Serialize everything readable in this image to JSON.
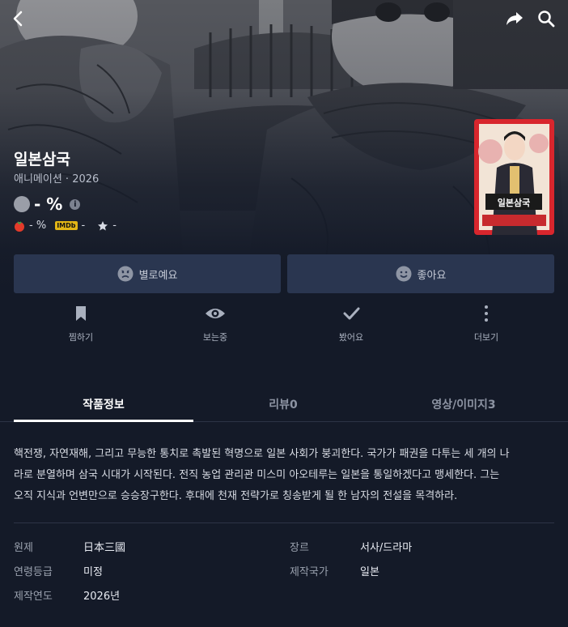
{
  "header": {
    "icons": [
      "back-icon",
      "share-icon",
      "search-icon"
    ]
  },
  "movie": {
    "title": "일본삼국",
    "meta": "애니메이션 · 2026",
    "score": "- %",
    "tomato_score": "- %",
    "imdb_badge": "IMDb",
    "imdb_score": "-",
    "star_score": "-",
    "poster_text": "일본삼국"
  },
  "buttons": {
    "dislike": "별로예요",
    "like": "좋아요"
  },
  "actions": [
    {
      "label": "찜하기",
      "icon": "bookmark-icon"
    },
    {
      "label": "보는중",
      "icon": "eye-icon"
    },
    {
      "label": "봤어요",
      "icon": "check-icon"
    },
    {
      "label": "더보기",
      "icon": "more-vertical-icon"
    }
  ],
  "tabs": [
    {
      "label": "작품정보",
      "active": true
    },
    {
      "label": "리뷰0",
      "active": false
    },
    {
      "label": "영상/이미지3",
      "active": false
    }
  ],
  "synopsis": {
    "line1": "핵전쟁, 자연재해, 그리고 무능한 통치로 촉발된 혁명으로 일본 사회가 붕괴한다. 국가가 패권을 다투는 세 개의 나",
    "line2": "라로 분열하며 삼국 시대가 시작된다. 전직 농업 관리관 미스미 아오테루는 일본을 통일하겠다고 맹세한다. 그는",
    "line3": "오직 지식과 언변만으로 승승장구한다. 후대에 천재 전략가로 칭송받게 될 한 남자의 전설을 목격하라."
  },
  "info": {
    "original_title_label": "원제",
    "original_title": "日本三國",
    "genre_label": "장르",
    "genre": "서사/드라마",
    "rating_label": "연령등급",
    "rating": "미정",
    "country_label": "제작국가",
    "country": "일본",
    "year_label": "제작연도",
    "year": "2026년"
  },
  "colors": {
    "background": "#141a28",
    "button": "#2a3650",
    "tomato": "#e33b2a",
    "imdb": "#e2b616"
  }
}
